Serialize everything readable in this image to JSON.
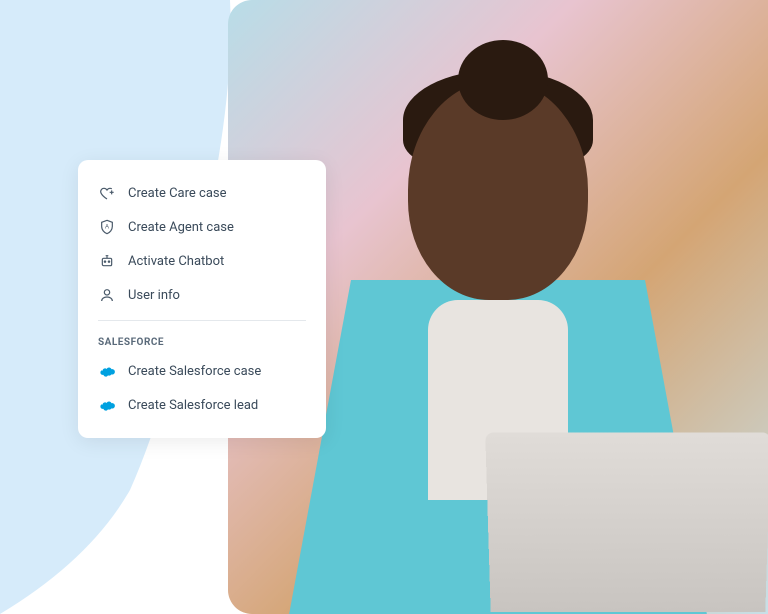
{
  "menu": {
    "items": [
      {
        "label": "Create Care case"
      },
      {
        "label": "Create Agent case"
      },
      {
        "label": "Activate Chatbot"
      },
      {
        "label": "User info"
      }
    ],
    "section_label": "SALESFORCE",
    "salesforce_items": [
      {
        "label": "Create Salesforce case"
      },
      {
        "label": "Create Salesforce lead"
      }
    ]
  }
}
